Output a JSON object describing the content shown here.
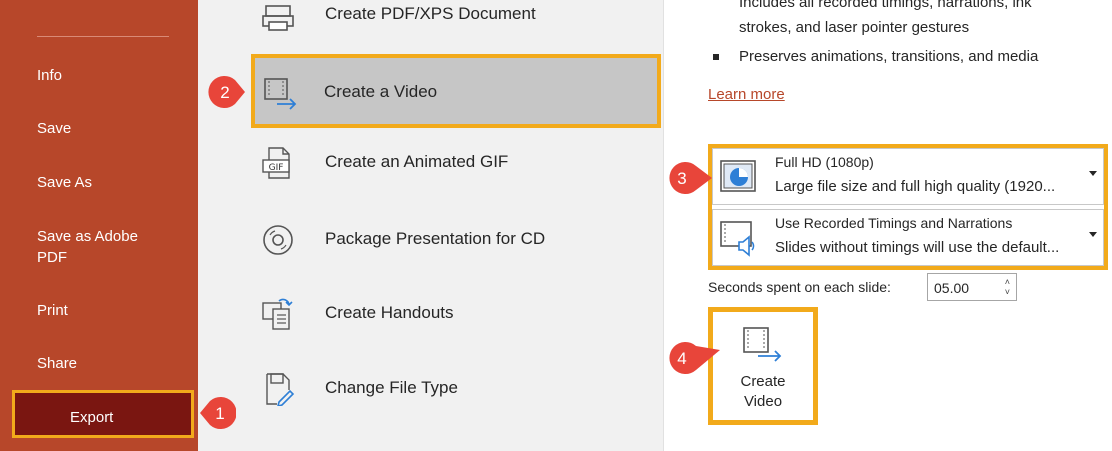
{
  "sidebar": {
    "items": [
      {
        "label": "Info"
      },
      {
        "label": "Save"
      },
      {
        "label": "Save As"
      },
      {
        "label": "Save as Adobe PDF"
      },
      {
        "label": "Print"
      },
      {
        "label": "Share"
      },
      {
        "label": "Export"
      }
    ]
  },
  "export_options": [
    {
      "label": "Create PDF/XPS Document",
      "icon": "document-icon"
    },
    {
      "label": "Create a Video",
      "icon": "video-icon"
    },
    {
      "label": "Create an Animated GIF",
      "icon": "gif-icon"
    },
    {
      "label": "Package Presentation for CD",
      "icon": "cd-icon"
    },
    {
      "label": "Create Handouts",
      "icon": "handouts-icon"
    },
    {
      "label": "Change File Type",
      "icon": "change-file-type-icon"
    }
  ],
  "details": {
    "bullet1_line1": "Includes all recorded timings, narrations, ink",
    "bullet1_line2": "strokes, and laser pointer gestures",
    "bullet2": "Preserves animations, transitions, and media",
    "learn_more": "Learn more"
  },
  "quality_dropdown": {
    "title": "Full HD (1080p)",
    "subtitle": "Large file size and full high quality (1920..."
  },
  "timings_dropdown": {
    "title": "Use Recorded Timings and Narrations",
    "subtitle": "Slides without timings will use the default..."
  },
  "seconds": {
    "label": "Seconds spent on each slide:",
    "value": "05.00"
  },
  "create_video_button": {
    "line1": "Create",
    "line2": "Video"
  },
  "callouts": [
    "1",
    "2",
    "3",
    "4"
  ],
  "colors": {
    "sidebar": "#b7472a",
    "export_selected": "#7a1611",
    "highlight_border": "#f2aa1b",
    "callout": "#e8453a",
    "selected_option": "#c6c6c6"
  }
}
